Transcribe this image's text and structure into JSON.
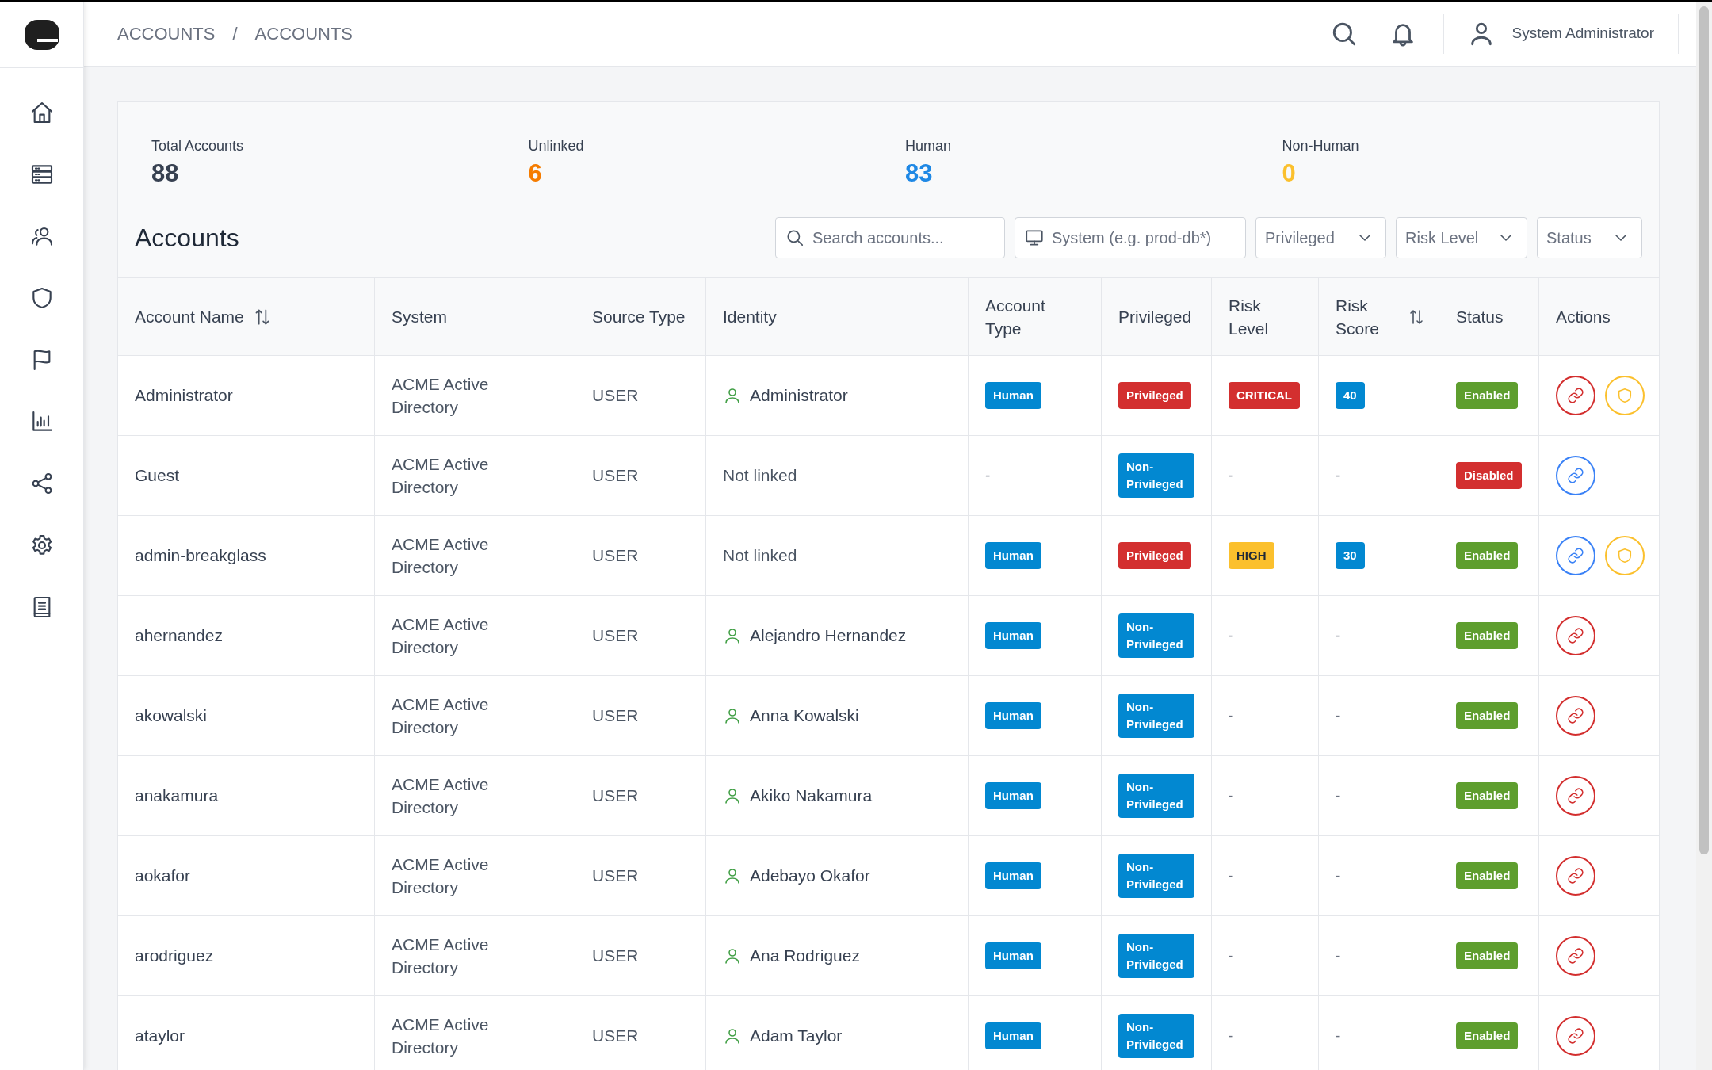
{
  "breadcrumb": {
    "items": [
      "ACCOUNTS",
      "ACCOUNTS"
    ],
    "separator": "/"
  },
  "user": {
    "name": "System Administrator"
  },
  "stats": [
    {
      "label": "Total Accounts",
      "value": "88",
      "color": "#374151"
    },
    {
      "label": "Unlinked",
      "value": "6",
      "color": "#f57c00"
    },
    {
      "label": "Human",
      "value": "83",
      "color": "#1e88e5"
    },
    {
      "label": "Non-Human",
      "value": "0",
      "color": "#fbc02d"
    }
  ],
  "title": "Accounts",
  "filters": [
    {
      "kind": "search",
      "placeholder": "Search accounts..."
    },
    {
      "kind": "system",
      "placeholder": "System (e.g. prod-db*)"
    },
    {
      "kind": "select",
      "label": "Privileged"
    },
    {
      "kind": "select",
      "label": "Risk Level"
    },
    {
      "kind": "select",
      "label": "Status"
    }
  ],
  "columns": [
    {
      "label": "Account Name",
      "sortable": true
    },
    {
      "label": "System",
      "sortable": false
    },
    {
      "label": "Source Type",
      "sortable": false
    },
    {
      "label": "Identity",
      "sortable": false
    },
    {
      "label": "Account Type",
      "sortable": false
    },
    {
      "label": "Privileged",
      "sortable": false
    },
    {
      "label": "Risk Level",
      "sortable": false
    },
    {
      "label": "Risk Score",
      "sortable": true
    },
    {
      "label": "Status",
      "sortable": false
    },
    {
      "label": "Actions",
      "sortable": false
    }
  ],
  "rows": [
    {
      "account": "Administrator",
      "system": "ACME Active Directory",
      "source": "USER",
      "identity": {
        "name": "Administrator",
        "linked": true
      },
      "type": "Human",
      "privileged": {
        "label": "Privileged",
        "kind": "privileged"
      },
      "risk_level": {
        "label": "CRITICAL",
        "kind": "critical"
      },
      "risk_score": "40",
      "status": {
        "label": "Enabled",
        "enabled": true
      },
      "actions": [
        {
          "kind": "link",
          "color": "#d32f2f"
        },
        {
          "kind": "shield",
          "color": "#fbc02d"
        }
      ]
    },
    {
      "account": "Guest",
      "system": "ACME Active Directory",
      "source": "USER",
      "identity": {
        "name": "Not linked",
        "linked": false
      },
      "type": "-",
      "privileged": {
        "label": "Non-Privileged",
        "kind": "non-privileged"
      },
      "risk_level": {
        "label": "-",
        "kind": "none"
      },
      "risk_score": "-",
      "status": {
        "label": "Disabled",
        "enabled": false
      },
      "actions": [
        {
          "kind": "link",
          "color": "#3b82f6"
        }
      ]
    },
    {
      "account": "admin-breakglass",
      "system": "ACME Active Directory",
      "source": "USER",
      "identity": {
        "name": "Not linked",
        "linked": false
      },
      "type": "Human",
      "privileged": {
        "label": "Privileged",
        "kind": "privileged"
      },
      "risk_level": {
        "label": "HIGH",
        "kind": "high"
      },
      "risk_score": "30",
      "status": {
        "label": "Enabled",
        "enabled": true
      },
      "actions": [
        {
          "kind": "link",
          "color": "#3b82f6"
        },
        {
          "kind": "shield",
          "color": "#fbc02d"
        }
      ]
    },
    {
      "account": "ahernandez",
      "system": "ACME Active Directory",
      "source": "USER",
      "identity": {
        "name": "Alejandro Hernandez",
        "linked": true
      },
      "type": "Human",
      "privileged": {
        "label": "Non-Privileged",
        "kind": "non-privileged"
      },
      "risk_level": {
        "label": "-",
        "kind": "none"
      },
      "risk_score": "-",
      "status": {
        "label": "Enabled",
        "enabled": true
      },
      "actions": [
        {
          "kind": "link",
          "color": "#d32f2f"
        }
      ]
    },
    {
      "account": "akowalski",
      "system": "ACME Active Directory",
      "source": "USER",
      "identity": {
        "name": "Anna Kowalski",
        "linked": true
      },
      "type": "Human",
      "privileged": {
        "label": "Non-Privileged",
        "kind": "non-privileged"
      },
      "risk_level": {
        "label": "-",
        "kind": "none"
      },
      "risk_score": "-",
      "status": {
        "label": "Enabled",
        "enabled": true
      },
      "actions": [
        {
          "kind": "link",
          "color": "#d32f2f"
        }
      ]
    },
    {
      "account": "anakamura",
      "system": "ACME Active Directory",
      "source": "USER",
      "identity": {
        "name": "Akiko Nakamura",
        "linked": true
      },
      "type": "Human",
      "privileged": {
        "label": "Non-Privileged",
        "kind": "non-privileged"
      },
      "risk_level": {
        "label": "-",
        "kind": "none"
      },
      "risk_score": "-",
      "status": {
        "label": "Enabled",
        "enabled": true
      },
      "actions": [
        {
          "kind": "link",
          "color": "#d32f2f"
        }
      ]
    },
    {
      "account": "aokafor",
      "system": "ACME Active Directory",
      "source": "USER",
      "identity": {
        "name": "Adebayo Okafor",
        "linked": true
      },
      "type": "Human",
      "privileged": {
        "label": "Non-Privileged",
        "kind": "non-privileged"
      },
      "risk_level": {
        "label": "-",
        "kind": "none"
      },
      "risk_score": "-",
      "status": {
        "label": "Enabled",
        "enabled": true
      },
      "actions": [
        {
          "kind": "link",
          "color": "#d32f2f"
        }
      ]
    },
    {
      "account": "arodriguez",
      "system": "ACME Active Directory",
      "source": "USER",
      "identity": {
        "name": "Ana Rodriguez",
        "linked": true
      },
      "type": "Human",
      "privileged": {
        "label": "Non-Privileged",
        "kind": "non-privileged"
      },
      "risk_level": {
        "label": "-",
        "kind": "none"
      },
      "risk_score": "-",
      "status": {
        "label": "Enabled",
        "enabled": true
      },
      "actions": [
        {
          "kind": "link",
          "color": "#d32f2f"
        }
      ]
    },
    {
      "account": "ataylor",
      "system": "ACME Active Directory",
      "source": "USER",
      "identity": {
        "name": "Adam Taylor",
        "linked": true
      },
      "type": "Human",
      "privileged": {
        "label": "Non-Privileged",
        "kind": "non-privileged"
      },
      "risk_level": {
        "label": "-",
        "kind": "none"
      },
      "risk_score": "-",
      "status": {
        "label": "Enabled",
        "enabled": true
      },
      "actions": [
        {
          "kind": "link",
          "color": "#d32f2f"
        }
      ]
    }
  ]
}
